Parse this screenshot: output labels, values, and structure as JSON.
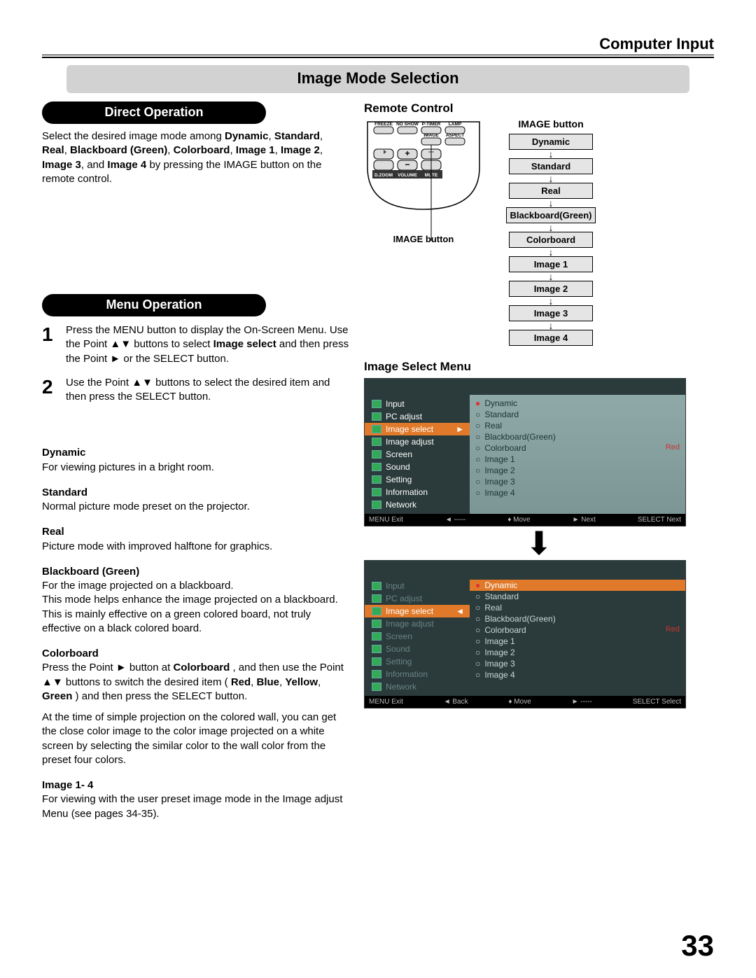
{
  "header": {
    "section_title": "Computer Input",
    "page_title": "Image Mode Selection"
  },
  "pagenumber": "33",
  "direct_operation": {
    "pill": "Direct Operation",
    "text_pre": "Select the desired image mode among ",
    "b1": "Dynamic",
    "c1": ", ",
    "b2": "Standard",
    "c2": ", ",
    "b3": "Real",
    "c3": ", ",
    "b4": "Blackboard (Green)",
    "c4": ", ",
    "b5": "Colorboard",
    "c5": ", ",
    "b6": "Image 1",
    "c6": ", ",
    "b7": "Image 2",
    "c7": ", ",
    "b8": "Image 3",
    "c8": ", and ",
    "b9": "Image 4",
    "text_post": " by pressing the IMAGE button on the remote control."
  },
  "menu_operation": {
    "pill": "Menu Operation",
    "step1_num": "1",
    "step1_pre": "Press the MENU button to display the On-Screen Menu. Use the Point ▲▼ buttons to select ",
    "step1_bold": "Image select",
    "step1_post": " and then press the Point ► or the SELECT button.",
    "step2_num": "2",
    "step2_text": "Use the Point ▲▼ buttons to select the desired item and then press the SELECT button."
  },
  "modes": {
    "dynamic": {
      "name": "Dynamic",
      "desc": "For viewing pictures in a bright room."
    },
    "standard": {
      "name": "Standard",
      "desc": "Normal picture mode preset on the projector."
    },
    "real": {
      "name": "Real",
      "desc": "Picture mode with improved halftone for graphics."
    },
    "blackboard": {
      "name": "Blackboard (Green)",
      "desc": "For the image projected on a blackboard.\nThis mode helps enhance the image projected on a blackboard. This is mainly effective on a green colored board, not truly effective on a black colored board."
    },
    "colorboard": {
      "name": "Colorboard",
      "p1_pre": "Press the Point ► button at ",
      "p1_b1": "Colorboard",
      "p1_mid": ", and then use the Point ▲▼ buttons to switch the desired item (",
      "p1_b2": "Red",
      "p1_c2": ", ",
      "p1_b3": "Blue",
      "p1_c3": ", ",
      "p1_b4": "Yellow",
      "p1_c4": ", ",
      "p1_b5": "Green",
      "p1_post": ") and then press the SELECT button.",
      "p2": "At the time of simple projection on the colored wall, you can get the close color image to the color image projected on a white screen by selecting the similar color to the wall color from the preset four colors."
    },
    "image14": {
      "name": "Image 1- 4",
      "desc": "For viewing with the user preset image mode in the Image adjust Menu (see pages 34-35)."
    }
  },
  "remote": {
    "heading": "Remote Control",
    "label": "IMAGE button",
    "btns": {
      "freeze": "FREEZE",
      "noshow": "NO SHOW",
      "ptimer": "P-TIMER",
      "lamp": "LAMP",
      "image": "IMAGE",
      "aspect": "ASPECT",
      "dzoom": "D.ZOOM",
      "volume": "VOLUME",
      "mute": "MUTE"
    }
  },
  "cycle": {
    "title": "IMAGE button",
    "items": [
      "Dynamic",
      "Standard",
      "Real",
      "Blackboard(Green)",
      "Colorboard",
      "Image 1",
      "Image 2",
      "Image 3",
      "Image 4"
    ]
  },
  "osd": {
    "heading": "Image Select Menu",
    "nav": [
      "Input",
      "PC adjust",
      "Image select",
      "Image adjust",
      "Screen",
      "Sound",
      "Setting",
      "Information",
      "Network"
    ],
    "opts": [
      "Dynamic",
      "Standard",
      "Real",
      "Blackboard(Green)",
      "Colorboard",
      "Image 1",
      "Image 2",
      "Image 3",
      "Image 4"
    ],
    "right_label": "Red",
    "foot1": {
      "a": "MENU Exit",
      "b": "◄ -----",
      "c": "♦ Move",
      "d": "► Next",
      "e": "SELECT Next"
    },
    "foot2": {
      "a": "MENU Exit",
      "b": "◄ Back",
      "c": "♦ Move",
      "d": "► -----",
      "e": "SELECT Select"
    }
  }
}
